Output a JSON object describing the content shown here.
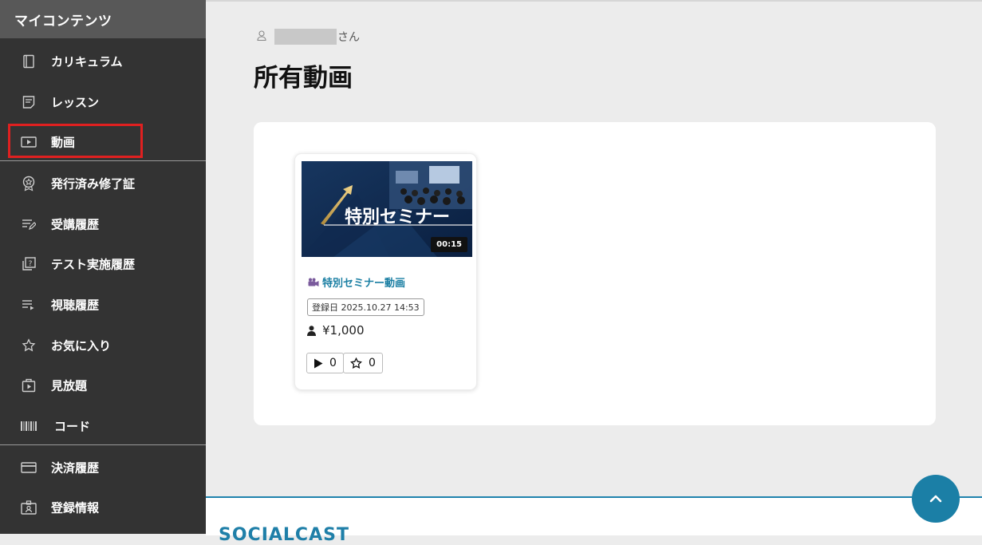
{
  "sidebar": {
    "title": "マイコンテンツ",
    "items": [
      {
        "label": "カリキュラム",
        "icon": "book-icon"
      },
      {
        "label": "レッスン",
        "icon": "document-icon"
      },
      {
        "label": "動画",
        "icon": "video-play-icon",
        "active": true
      },
      {
        "label": "発行済み修了証",
        "icon": "award-badge-icon"
      },
      {
        "label": "受講履歴",
        "icon": "list-edit-icon"
      },
      {
        "label": "テスト実施履歴",
        "icon": "quiz-icon"
      },
      {
        "label": "視聴履歴",
        "icon": "list-play-icon"
      },
      {
        "label": "お気に入り",
        "icon": "star-icon"
      },
      {
        "label": "見放題",
        "icon": "video-folder-icon"
      },
      {
        "label": "コード",
        "icon": "barcode-icon"
      },
      {
        "label": "決済履歴",
        "icon": "credit-card-icon"
      },
      {
        "label": "登録情報",
        "icon": "id-card-icon"
      }
    ]
  },
  "user": {
    "suffix": "さん"
  },
  "page": {
    "title": "所有動画"
  },
  "video_card": {
    "thumbnail_text": "特別セミナー",
    "duration": "00:15",
    "title": "特別セミナー動画",
    "registered": "登録日 2025.10.27 14:53",
    "price": "¥1,000",
    "play_count": "0",
    "favorite_count": "0"
  },
  "footer": {
    "brand": "SOCIALCAST"
  },
  "colors": {
    "sidebar_bg": "#333333",
    "accent": "#1b7fa6",
    "active_outline": "#e02020"
  }
}
